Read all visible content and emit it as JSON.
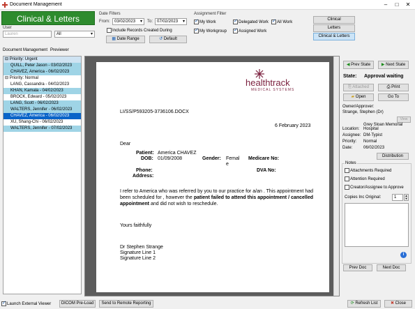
{
  "window": {
    "title": "Document Management"
  },
  "banner": {
    "title": "Clinical & Letters"
  },
  "user": {
    "label": "User",
    "value": "Lauren",
    "filter": "All"
  },
  "date_filters": {
    "label": "Date Filters",
    "from_label": "From:",
    "from_value": "03/02/2023",
    "to_label": "To:",
    "to_value": "07/02/2023",
    "include_label": "Include Records Created During",
    "date_range_label": "Date Range",
    "default_label": "Default"
  },
  "assignment_filter": {
    "label": "Assignment Filter",
    "my_work": "My Work",
    "delegated_work": "Delegated Work",
    "all_work": "All Work",
    "my_workgroup": "My Workgroup",
    "assigned_work": "Assigned Work"
  },
  "mode_buttons": {
    "clinical": "Clinical",
    "letters": "Letters",
    "clinical_letters": "Clinical & Letters"
  },
  "tabs": {
    "doc_mgmt": "Document Management",
    "previewer": "Previewer"
  },
  "list": {
    "urgent_label": "Priority: Urgent",
    "normal_label": "Priority: Normal",
    "urgent": [
      "QUILL, Peter Jason  - 03/02/2023",
      "CHAVEZ, America  - 06/02/2023"
    ],
    "normal": [
      "LANG, Cassandra  - 04/02/2023",
      "KHAN, Kamala  - 04/02/2023",
      "BROCK, Edward  - 05/02/2023",
      "LANG, Scott  - 06/02/2023",
      "WALTERS, Jennifer  - 06/02/2023",
      "CHAVEZ, America  - 06/02/2023",
      "XU, Shang-Chi  - 06/02/2023",
      "WALTERS, Jennifer  - 07/02/2023"
    ]
  },
  "document": {
    "logo_main": "healthtrack",
    "logo_sub": "MEDICAL SYSTEMS",
    "ref": "LI/SS/P593205-3736106.DOCX",
    "date": "6 February 2023",
    "greeting": "Dear",
    "patient_label": "Patient:",
    "patient_value": "America CHAVEZ",
    "dob_label": "DOB:",
    "dob_value": "01/09/2008",
    "gender_label": "Gender:",
    "gender_value_1": "Femal",
    "gender_value_2": "e",
    "medicare_label": "Medicare No:",
    "phone_label": "Phone:",
    "dva_label": "DVA No:",
    "address_label": "Address:",
    "body_1": "I refer to America who was referred by you to our practice for a/an .  This appointment had been scheduled for , however the ",
    "body_bold": "patient failed to attend this appointment / cancelled appointment",
    "body_2": " and did not wish to reschedule.",
    "closing": "Yours faithfully",
    "sig_name": "Dr Stephen Strange",
    "sig_line1": "Signature Line 1",
    "sig_line2": "Signature Line 2"
  },
  "right_panel": {
    "prev_state": "Prev State",
    "next_state": "Next State",
    "state_label": "State:",
    "state_value": "Approval waiting",
    "attached": "Attached",
    "print": "Print",
    "open": "Open",
    "goto": "Go To",
    "owner_label": "Owner/Approver:",
    "owner_value": "Strange, Stephen (Dr)",
    "view_label": "View",
    "location_label": "Location:",
    "location_value": "Grey Sloan Memorial Hospital",
    "assignee_label": "Assignee:",
    "assignee_value": "DM-Typist",
    "priority_label": "Priority:",
    "priority_value": "Normal",
    "date_label": "Date:",
    "date_value": "06/02/2023",
    "distribution": "Distribution",
    "notes_label": "Notes",
    "attachments_required": "Attachments Required",
    "attention_required": "Attention Required",
    "creator_approve": "Creator/Assignee to Approve",
    "copies_label": "Copies Inc Original:",
    "copies_value": "1",
    "prev_doc": "Prev Doc",
    "next_doc": "Next Doc"
  },
  "bottom": {
    "launch_viewer": "Launch External Viewer",
    "dicom": "DICOM Pre-Load",
    "remote": "Send to Remote Reporting",
    "refresh": "Refresh List",
    "close": "Close"
  },
  "colors": {
    "banner": "#2e8b2e",
    "selected": "#0a64c8",
    "highlight": "#9fd4e6",
    "logo": "#7a1f3d"
  }
}
